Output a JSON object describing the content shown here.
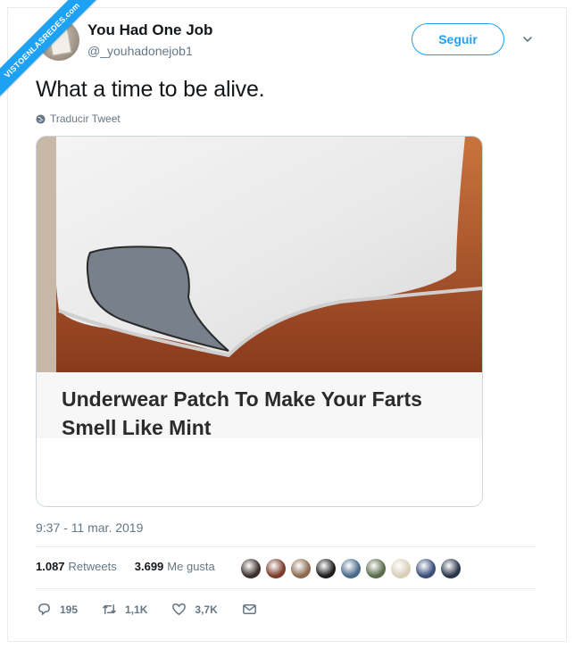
{
  "watermark": "VISTOENLASREDES.com",
  "author": {
    "name": "You Had One Job",
    "handle": "@_youhadonejob1"
  },
  "follow_button": "Seguir",
  "tweet": {
    "text": "What a time to be alive.",
    "translate_label": "Traducir Tweet",
    "media_caption": "Underwear Patch To Make Your Farts Smell Like Mint",
    "timestamp": "9:37 - 11 mar. 2019"
  },
  "stats": {
    "retweets_count": "1.087",
    "retweets_label": "Retweets",
    "likes_count": "3.699",
    "likes_label": "Me gusta"
  },
  "liker_colors": [
    "#3b2f2a",
    "#7a3b2a",
    "#8b6a4f",
    "#1d1d1d",
    "#4a6a8a",
    "#5b6b4a",
    "#d8cfb8",
    "#3a4d7a",
    "#2a3548"
  ],
  "actions": {
    "replies": "195",
    "retweets": "1,1K",
    "likes": "3,7K"
  },
  "colors": {
    "accent": "#1da1f2",
    "secondary_text": "#657786",
    "primary_text": "#14171a"
  }
}
